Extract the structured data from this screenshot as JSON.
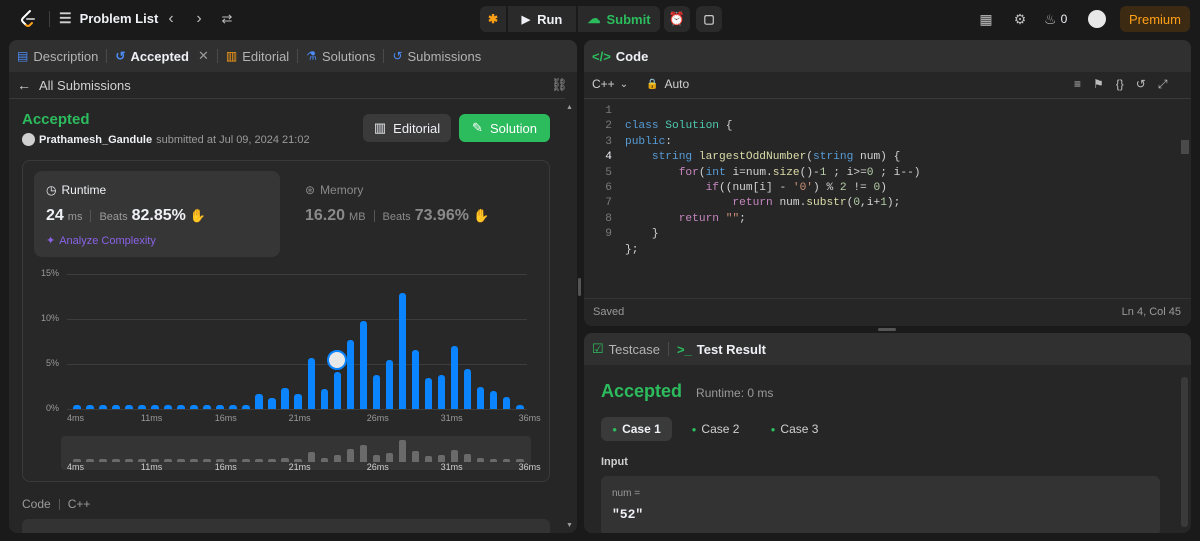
{
  "topbar": {
    "problem_list": "Problem List",
    "run": "Run",
    "submit": "Submit",
    "streak": "0",
    "premium": "Premium"
  },
  "left": {
    "tabs": [
      "Description",
      "Accepted",
      "Editorial",
      "Solutions",
      "Submissions"
    ],
    "back": "All Submissions",
    "status": "Accepted",
    "user": "Prathamesh_Gandule",
    "submitted": "submitted at Jul 09, 2024 21:02",
    "editorial_btn": "Editorial",
    "solution_btn": "Solution",
    "runtime": {
      "label": "Runtime",
      "value": "24",
      "unit": "ms",
      "beats_label": "Beats",
      "beats": "82.85%"
    },
    "memory": {
      "label": "Memory",
      "value": "16.20",
      "unit": "MB",
      "beats_label": "Beats",
      "beats": "73.96%"
    },
    "analyze": "Analyze Complexity",
    "code_label": "Code",
    "lang_label": "C++"
  },
  "chart_data": {
    "type": "bar",
    "y_ticks": [
      "15%",
      "10%",
      "5%",
      "0%"
    ],
    "x_ticks": [
      "4ms",
      "11ms",
      "16ms",
      "21ms",
      "26ms",
      "31ms",
      "36ms"
    ],
    "ylim": [
      0,
      15
    ],
    "values": [
      0.5,
      0.5,
      0.5,
      0.5,
      0.5,
      0.5,
      0.5,
      0.5,
      0.5,
      0.5,
      0.5,
      0.5,
      0.5,
      0.5,
      1.7,
      1.2,
      2.3,
      1.7,
      5.7,
      2.2,
      4.1,
      7.7,
      9.8,
      3.8,
      5.4,
      12.9,
      6.6,
      3.4,
      3.8,
      7.0,
      4.4,
      2.4,
      2.0,
      1.3,
      0.5
    ],
    "highlight_index": 20
  },
  "editor": {
    "title": "Code",
    "lang": "C++",
    "mode": "Auto",
    "status": "Saved",
    "position": "Ln 4, Col 45",
    "line_numbers": [
      "1",
      "2",
      "3",
      "4",
      "5",
      "6",
      "7",
      "8",
      "9"
    ]
  },
  "result": {
    "testcase_tab": "Testcase",
    "result_tab": "Test Result",
    "status": "Accepted",
    "runtime": "Runtime: 0 ms",
    "cases": [
      "Case 1",
      "Case 2",
      "Case 3"
    ],
    "input_label": "Input",
    "var_name": "num =",
    "var_value": "\"52\""
  },
  "colors": {
    "accent_green": "#2cbb5d",
    "bar_blue": "#0a84ff",
    "premium": "#ffa116"
  }
}
